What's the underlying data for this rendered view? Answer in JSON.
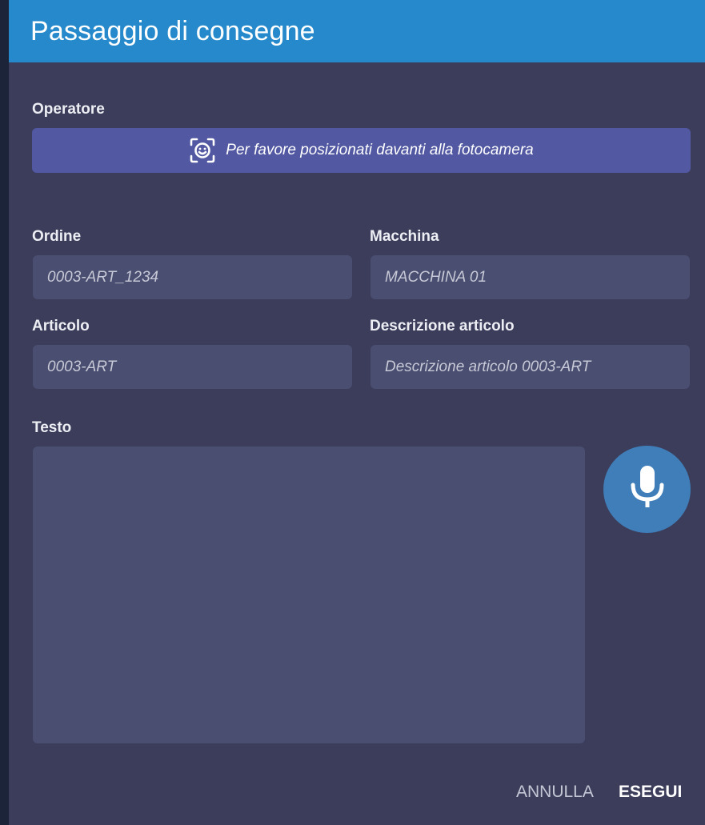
{
  "dialog": {
    "title": "Passaggio di consegne"
  },
  "operator": {
    "label": "Operatore",
    "camera_prompt": "Per favore posizionati davanti alla fotocamera",
    "icon": "face-scan-icon"
  },
  "fields": {
    "order": {
      "label": "Ordine",
      "value": "0003-ART_1234"
    },
    "machine": {
      "label": "Macchina",
      "value": "MACCHINA 01"
    },
    "article": {
      "label": "Articolo",
      "value": "0003-ART"
    },
    "description": {
      "label": "Descrizione articolo",
      "value": "Descrizione articolo 0003-ART"
    }
  },
  "text": {
    "label": "Testo",
    "value": "",
    "mic_icon": "microphone-icon"
  },
  "actions": {
    "cancel_label": "ANNULLA",
    "ok_label": "ESEGUI"
  },
  "colors": {
    "header": "#2589cb",
    "background": "#3c3d5b",
    "camera_button": "#5259a2",
    "field": "#4a4e71",
    "mic_button": "#3f7eb9"
  }
}
